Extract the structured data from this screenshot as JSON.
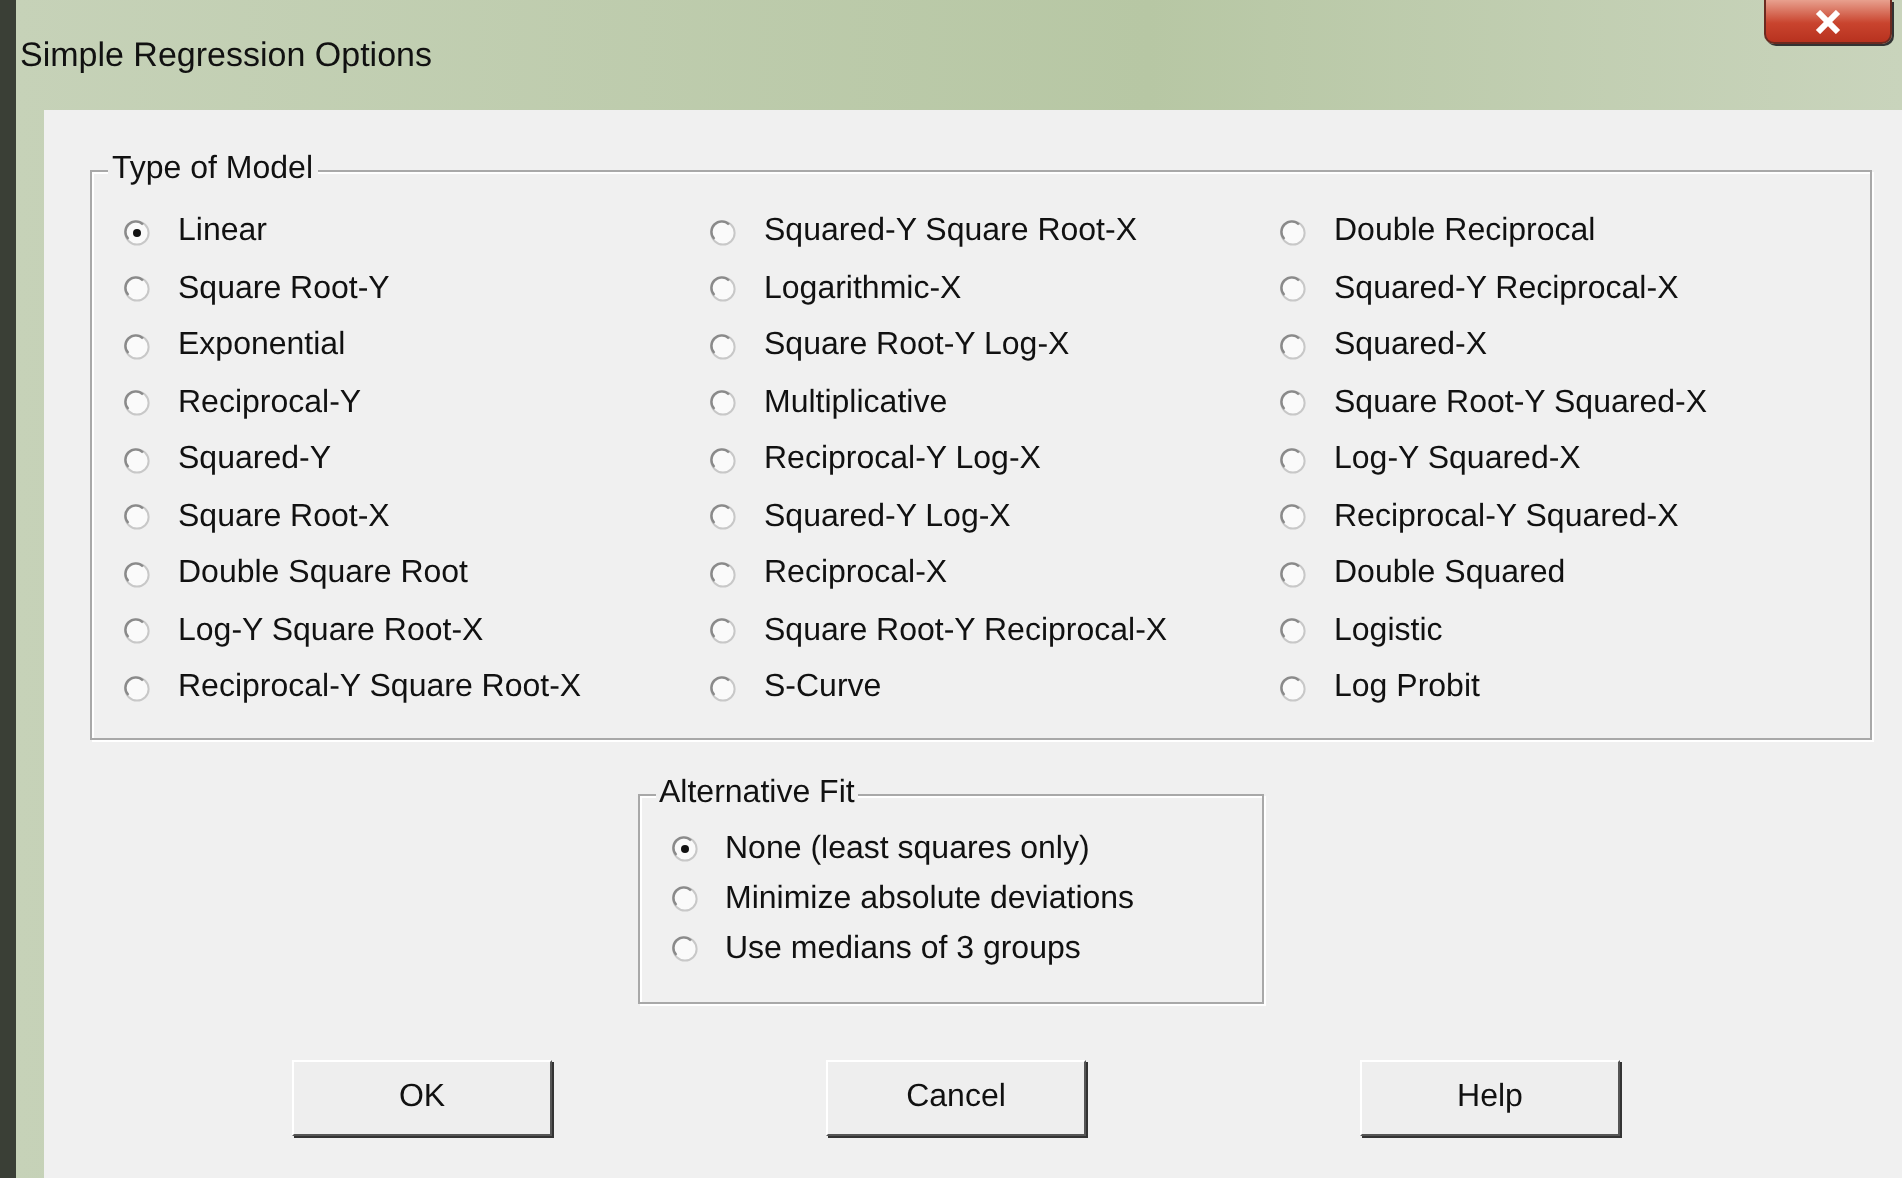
{
  "window": {
    "title": "Simple Regression Options"
  },
  "type_of_model": {
    "title": "Type of Model",
    "columns": [
      {
        "options": [
          {
            "label": "Linear",
            "selected": true
          },
          {
            "label": "Square Root-Y",
            "selected": false
          },
          {
            "label": "Exponential",
            "selected": false
          },
          {
            "label": "Reciprocal-Y",
            "selected": false
          },
          {
            "label": "Squared-Y",
            "selected": false
          },
          {
            "label": "Square Root-X",
            "selected": false
          },
          {
            "label": "Double Square Root",
            "selected": false
          },
          {
            "label": "Log-Y Square Root-X",
            "selected": false
          },
          {
            "label": "Reciprocal-Y Square Root-X",
            "selected": false
          }
        ]
      },
      {
        "options": [
          {
            "label": "Squared-Y Square Root-X",
            "selected": false
          },
          {
            "label": "Logarithmic-X",
            "selected": false
          },
          {
            "label": "Square Root-Y Log-X",
            "selected": false
          },
          {
            "label": "Multiplicative",
            "selected": false
          },
          {
            "label": "Reciprocal-Y Log-X",
            "selected": false
          },
          {
            "label": "Squared-Y Log-X",
            "selected": false
          },
          {
            "label": "Reciprocal-X",
            "selected": false
          },
          {
            "label": "Square Root-Y Reciprocal-X",
            "selected": false
          },
          {
            "label": "S-Curve",
            "selected": false
          }
        ]
      },
      {
        "options": [
          {
            "label": "Double Reciprocal",
            "selected": false
          },
          {
            "label": "Squared-Y Reciprocal-X",
            "selected": false
          },
          {
            "label": "Squared-X",
            "selected": false
          },
          {
            "label": "Square Root-Y Squared-X",
            "selected": false
          },
          {
            "label": "Log-Y Squared-X",
            "selected": false
          },
          {
            "label": "Reciprocal-Y Squared-X",
            "selected": false
          },
          {
            "label": "Double Squared",
            "selected": false
          },
          {
            "label": "Logistic",
            "selected": false
          },
          {
            "label": "Log Probit",
            "selected": false
          }
        ]
      }
    ]
  },
  "alternative_fit": {
    "title": "Alternative Fit",
    "options": [
      {
        "label": "None (least squares only)",
        "selected": true
      },
      {
        "label": "Minimize absolute deviations",
        "selected": false
      },
      {
        "label": "Use medians of 3 groups",
        "selected": false
      }
    ]
  },
  "buttons": [
    "OK",
    "Cancel",
    "Help"
  ]
}
